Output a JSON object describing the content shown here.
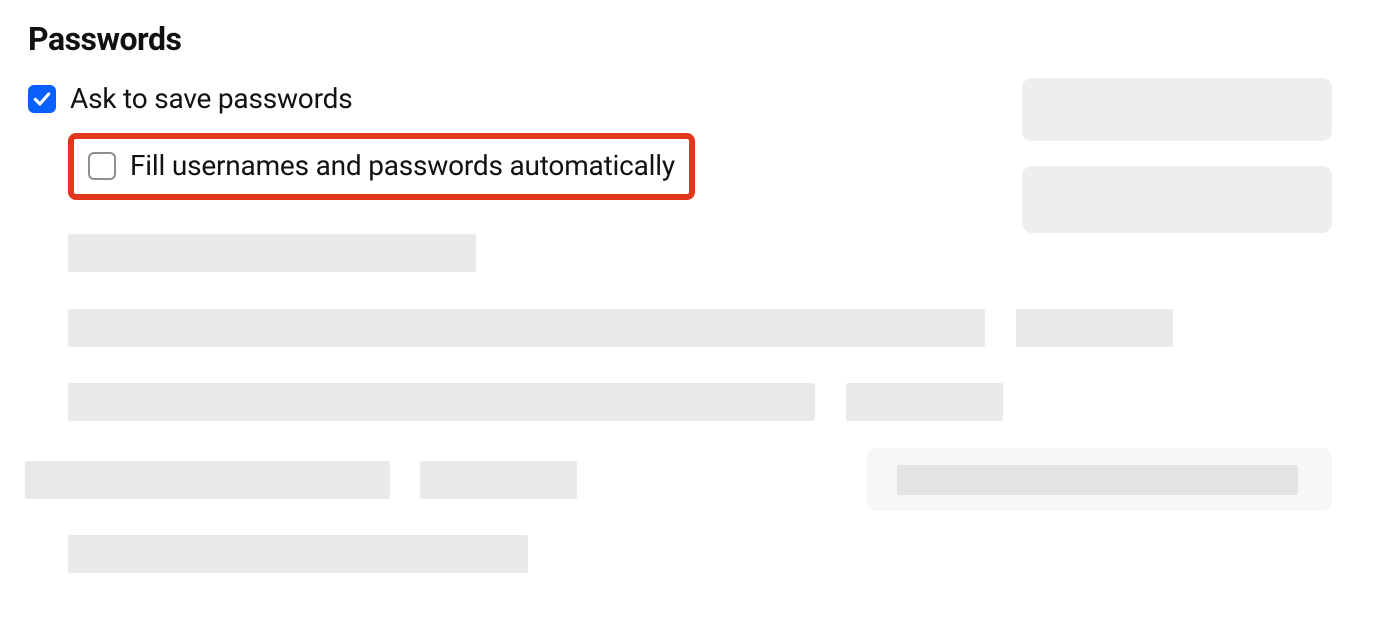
{
  "section": {
    "title": "Passwords"
  },
  "options": {
    "ask_to_save": {
      "label": "Ask to save passwords",
      "checked": true
    },
    "autofill": {
      "label": "Fill usernames and passwords automatically",
      "checked": false,
      "highlighted": true
    }
  }
}
